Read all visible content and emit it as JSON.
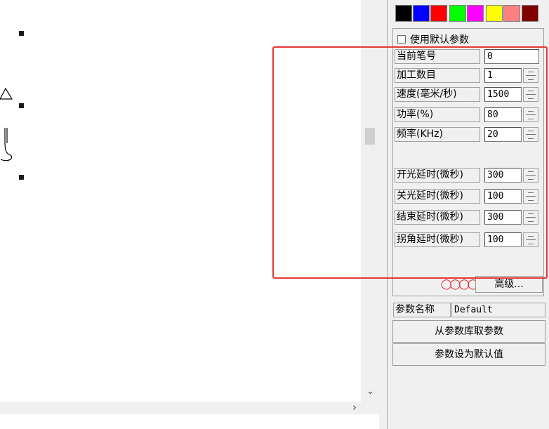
{
  "colors": {
    "swatches": [
      "#000000",
      "#0000ff",
      "#ff0000",
      "#00ff00",
      "#ff00ff",
      "#ffff00",
      "#ff8080",
      "#800000"
    ],
    "highlight": "#e53935"
  },
  "panel": {
    "use_default_label": "使用默认参数",
    "rows": [
      {
        "label": "当前笔号",
        "value": "0",
        "spinner": false
      },
      {
        "label": "加工数目",
        "value": "1",
        "spinner": true
      },
      {
        "label": "速度(毫米/秒)",
        "value": "1500",
        "spinner": true
      },
      {
        "label": "功率(%)",
        "value": "80",
        "spinner": true
      },
      {
        "label": "频率(KHz)",
        "value": "20",
        "spinner": true
      },
      {
        "label": "开光延时(微秒)",
        "value": "300",
        "spinner": true
      },
      {
        "label": "关光延时(微秒)",
        "value": "100",
        "spinner": true
      },
      {
        "label": "结束延时(微秒)",
        "value": "300",
        "spinner": true
      },
      {
        "label": "拐角延时(微秒)",
        "value": "100",
        "spinner": true
      }
    ],
    "rings_icon": "ring-chain-icon",
    "advanced_label": "高级...",
    "param_name_label": "参数名称",
    "param_name_value": "Default",
    "load_from_lib_label": "从参数库取参数",
    "set_default_label": "参数设为默认值"
  },
  "scrollbar": {
    "down_icon": "chevron-down-icon",
    "right_icon": "chevron-right-icon"
  }
}
